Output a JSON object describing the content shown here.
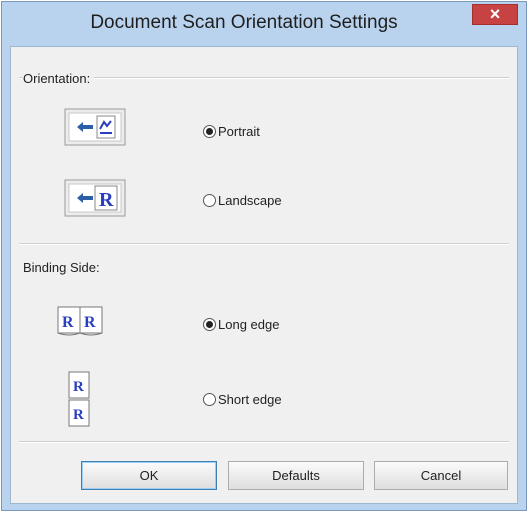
{
  "window": {
    "title": "Document Scan Orientation Settings",
    "close_label": "×"
  },
  "orientation": {
    "label": "Orientation:",
    "options": [
      {
        "label": "Portrait",
        "selected": true,
        "icon": "portrait-orientation-icon"
      },
      {
        "label": "Landscape",
        "selected": false,
        "icon": "landscape-orientation-icon"
      }
    ]
  },
  "binding": {
    "label": "Binding Side:",
    "options": [
      {
        "label": "Long edge",
        "selected": true,
        "icon": "long-edge-binding-icon"
      },
      {
        "label": "Short edge",
        "selected": false,
        "icon": "short-edge-binding-icon"
      }
    ]
  },
  "buttons": {
    "ok": "OK",
    "defaults": "Defaults",
    "cancel": "Cancel"
  },
  "colors": {
    "frame": "#b9d3ee",
    "close": "#c74343",
    "icon_letter": "#2a3fbf",
    "arrow": "#2b5da8"
  }
}
